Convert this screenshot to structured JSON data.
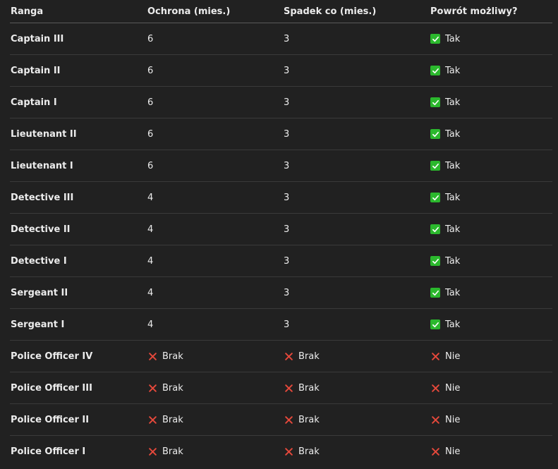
{
  "headers": [
    "Ranga",
    "Ochrona (mies.)",
    "Spadek co (mies.)",
    "Powrót możliwy?"
  ],
  "rows": [
    {
      "rank": "Captain III",
      "protection": "6",
      "decay": "3",
      "return": "Tak"
    },
    {
      "rank": "Captain II",
      "protection": "6",
      "decay": "3",
      "return": "Tak"
    },
    {
      "rank": "Captain I",
      "protection": "6",
      "decay": "3",
      "return": "Tak"
    },
    {
      "rank": "Lieutenant II",
      "protection": "6",
      "decay": "3",
      "return": "Tak"
    },
    {
      "rank": "Lieutenant I",
      "protection": "6",
      "decay": "3",
      "return": "Tak"
    },
    {
      "rank": "Detective III",
      "protection": "4",
      "decay": "3",
      "return": "Tak"
    },
    {
      "rank": "Detective II",
      "protection": "4",
      "decay": "3",
      "return": "Tak"
    },
    {
      "rank": "Detective I",
      "protection": "4",
      "decay": "3",
      "return": "Tak"
    },
    {
      "rank": "Sergeant II",
      "protection": "4",
      "decay": "3",
      "return": "Tak"
    },
    {
      "rank": "Sergeant I",
      "protection": "4",
      "decay": "3",
      "return": "Tak"
    },
    {
      "rank": "Police Officer IV",
      "protection": "Brak",
      "decay": "Brak",
      "return": "Nie"
    },
    {
      "rank": "Police Officer III",
      "protection": "Brak",
      "decay": "Brak",
      "return": "Nie"
    },
    {
      "rank": "Police Officer II",
      "protection": "Brak",
      "decay": "Brak",
      "return": "Nie"
    },
    {
      "rank": "Police Officer I",
      "protection": "Brak",
      "decay": "Brak",
      "return": "Nie"
    }
  ],
  "icons": {
    "yes": "check-mark-icon",
    "no": "cross-mark-icon"
  },
  "colors": {
    "background": "#212121",
    "check": "#2bb82d",
    "cross": "#e5483b"
  }
}
